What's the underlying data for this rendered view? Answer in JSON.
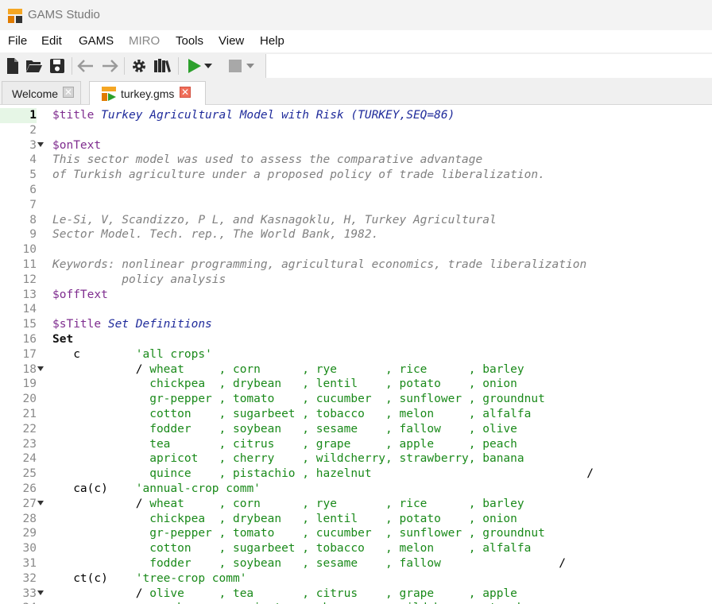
{
  "window": {
    "title": "GAMS Studio"
  },
  "menu": [
    "File",
    "Edit",
    "GAMS",
    "MIRO",
    "Tools",
    "View",
    "Help"
  ],
  "toolbar": {
    "icons": [
      "new-file-icon",
      "open-folder-icon",
      "save-icon",
      "back-arrow-icon",
      "forward-arrow-icon",
      "settings-gear-icon",
      "model-library-icon",
      "run-icon",
      "run-dropdown-icon",
      "stop-icon",
      "stop-dropdown-icon"
    ]
  },
  "tabs": [
    {
      "label": "Welcome",
      "active": false
    },
    {
      "label": "turkey.gms",
      "active": true
    }
  ],
  "editor": {
    "current_line": 1,
    "lines": [
      {
        "n": "1",
        "fold": false,
        "tokens": [
          [
            "kw",
            "$title "
          ],
          [
            "ttl",
            "Turkey Agricultural Model with Risk (TURKEY,SEQ=86)"
          ]
        ]
      },
      {
        "n": "2",
        "fold": false,
        "tokens": []
      },
      {
        "n": "3",
        "fold": true,
        "tokens": [
          [
            "kw",
            "$onText"
          ]
        ]
      },
      {
        "n": "4",
        "fold": false,
        "tokens": [
          [
            "cmt",
            "This sector model was used to assess the comparative advantage"
          ]
        ]
      },
      {
        "n": "5",
        "fold": false,
        "tokens": [
          [
            "cmt",
            "of Turkish agriculture under a proposed policy of trade liberalization."
          ]
        ]
      },
      {
        "n": "6",
        "fold": false,
        "tokens": []
      },
      {
        "n": "7",
        "fold": false,
        "tokens": []
      },
      {
        "n": "8",
        "fold": false,
        "tokens": [
          [
            "cmt",
            "Le-Si, V, Scandizzo, P L, and Kasnagoklu, H, Turkey Agricultural"
          ]
        ]
      },
      {
        "n": "9",
        "fold": false,
        "tokens": [
          [
            "cmt",
            "Sector Model. Tech. rep., The World Bank, 1982."
          ]
        ]
      },
      {
        "n": "10",
        "fold": false,
        "tokens": []
      },
      {
        "n": "11",
        "fold": false,
        "tokens": [
          [
            "cmt",
            "Keywords: nonlinear programming, agricultural economics, trade liberalization"
          ]
        ]
      },
      {
        "n": "12",
        "fold": false,
        "tokens": [
          [
            "cmt",
            "          policy analysis"
          ]
        ]
      },
      {
        "n": "13",
        "fold": false,
        "tokens": [
          [
            "kw",
            "$offText"
          ]
        ]
      },
      {
        "n": "14",
        "fold": false,
        "tokens": []
      },
      {
        "n": "15",
        "fold": false,
        "tokens": [
          [
            "kw",
            "$sTitle "
          ],
          [
            "ttl",
            "Set Definitions"
          ]
        ]
      },
      {
        "n": "16",
        "fold": false,
        "tokens": [
          [
            "set",
            "Set"
          ]
        ]
      },
      {
        "n": "17",
        "fold": false,
        "tokens": [
          [
            "id",
            "   c        "
          ],
          [
            "str",
            "'all crops'"
          ]
        ]
      },
      {
        "n": "18",
        "fold": true,
        "tokens": [
          [
            "id",
            "            / "
          ],
          [
            "el",
            "wheat     , corn      , rye       , rice      , barley"
          ]
        ]
      },
      {
        "n": "19",
        "fold": false,
        "tokens": [
          [
            "el",
            "              chickpea  , drybean   , lentil    , potato    , onion"
          ]
        ]
      },
      {
        "n": "20",
        "fold": false,
        "tokens": [
          [
            "el",
            "              gr-pepper , tomato    , cucumber  , sunflower , groundnut"
          ]
        ]
      },
      {
        "n": "21",
        "fold": false,
        "tokens": [
          [
            "el",
            "              cotton    , sugarbeet , tobacco   , melon     , alfalfa"
          ]
        ]
      },
      {
        "n": "22",
        "fold": false,
        "tokens": [
          [
            "el",
            "              fodder    , soybean   , sesame    , fallow    , olive"
          ]
        ]
      },
      {
        "n": "23",
        "fold": false,
        "tokens": [
          [
            "el",
            "              tea       , citrus    , grape     , apple     , peach"
          ]
        ]
      },
      {
        "n": "24",
        "fold": false,
        "tokens": [
          [
            "el",
            "              apricot   , cherry    , wildcherry, strawberry, banana"
          ]
        ]
      },
      {
        "n": "25",
        "fold": false,
        "tokens": [
          [
            "el",
            "              quince    , pistachio , hazelnut                               "
          ],
          [
            "id",
            "/"
          ]
        ]
      },
      {
        "n": "26",
        "fold": false,
        "tokens": [
          [
            "id",
            "   ca(c)    "
          ],
          [
            "str",
            "'annual-crop comm'"
          ]
        ]
      },
      {
        "n": "27",
        "fold": true,
        "tokens": [
          [
            "id",
            "            / "
          ],
          [
            "el",
            "wheat     , corn      , rye       , rice      , barley"
          ]
        ]
      },
      {
        "n": "28",
        "fold": false,
        "tokens": [
          [
            "el",
            "              chickpea  , drybean   , lentil    , potato    , onion"
          ]
        ]
      },
      {
        "n": "29",
        "fold": false,
        "tokens": [
          [
            "el",
            "              gr-pepper , tomato    , cucumber  , sunflower , groundnut"
          ]
        ]
      },
      {
        "n": "30",
        "fold": false,
        "tokens": [
          [
            "el",
            "              cotton    , sugarbeet , tobacco   , melon     , alfalfa"
          ]
        ]
      },
      {
        "n": "31",
        "fold": false,
        "tokens": [
          [
            "el",
            "              fodder    , soybean   , sesame    , fallow                 "
          ],
          [
            "id",
            "/"
          ]
        ]
      },
      {
        "n": "32",
        "fold": false,
        "tokens": [
          [
            "id",
            "   ct(c)    "
          ],
          [
            "str",
            "'tree-crop comm'"
          ]
        ]
      },
      {
        "n": "33",
        "fold": true,
        "tokens": [
          [
            "id",
            "            / "
          ],
          [
            "el",
            "olive     , tea       , citrus    , grape     , apple"
          ]
        ]
      },
      {
        "n": "34",
        "fold": false,
        "tokens": [
          [
            "el",
            "              peach     , apricot   , cherry    , wildcherry, strawberry"
          ]
        ]
      }
    ]
  },
  "colors": {
    "keyword": "#7f2d8f",
    "title": "#1f2b9b",
    "comment": "#808080",
    "string": "#1a8a1a",
    "run": "#2ca02c",
    "close": "#f06e5a"
  }
}
